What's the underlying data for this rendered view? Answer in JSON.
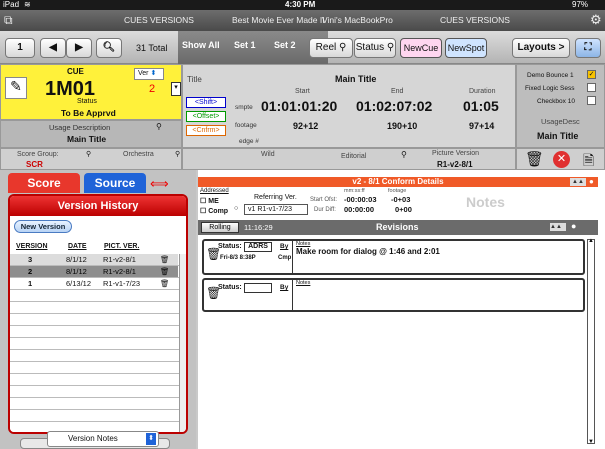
{
  "status_bar": {
    "device": "iPad",
    "time": "4:30 PM",
    "battery": "97%"
  },
  "title_bar": {
    "app": "CUES VERSIONS",
    "project": "Best Movie Ever Made II",
    "machine": "Vini's MacBookPro",
    "section": "CUES VERSIONS"
  },
  "toolbar": {
    "record_number": "1",
    "total": "31 Total",
    "show_all": "Show All",
    "set1": "Set 1",
    "set2": "Set 2",
    "reel": "Reel",
    "status": "Status",
    "new_cue": "NewCue",
    "new_spot": "NewSpot",
    "layouts": "Layouts >"
  },
  "cue": {
    "label": "CUE",
    "ver_label": "Ver",
    "number": "1M01",
    "version": "2",
    "status_label": "Status",
    "status_value": "To Be Apprvd"
  },
  "usage": {
    "label": "Usage Description",
    "value": "Main Title"
  },
  "score_group": {
    "label": "Score Group:",
    "value": "SCR",
    "orchestra_label": "Orchestra"
  },
  "timing": {
    "title_label": "Title",
    "title_value": "Main Title",
    "start_label": "Start",
    "end_label": "End",
    "duration_label": "Duration",
    "shift": "<Shift>",
    "offset": "<Offset>",
    "cnfrm": "<Cnfrm>",
    "smpte_label": "smpte",
    "start_smpte": "01:01:01:20",
    "end_smpte": "01:02:07:02",
    "dur_smpte": "01:05",
    "footage_label": "footage",
    "start_footage": "92+12",
    "end_footage": "190+10",
    "dur_footage": "97+14",
    "edge_label": "edge #"
  },
  "right_panel": {
    "items": [
      "Demo Bounce 1",
      "Fixed Logic Sess",
      "Checkbox 10"
    ],
    "usage_desc_label": "UsageDesc",
    "usage_desc_value": "Main Title"
  },
  "wild_row": {
    "wild_label": "Wild",
    "editorial_label": "Editorial",
    "picture_version_label": "Picture Version",
    "picture_version_value": "R1-v2-8/1"
  },
  "left": {
    "tab_score": "Score",
    "tab_source": "Source",
    "version_history_title": "Version History",
    "new_version": "New Version",
    "columns": [
      "VERSION",
      "DATE",
      "PICT. VER."
    ],
    "rows": [
      [
        "3",
        "8/1/12",
        "R1-v2-8/1"
      ],
      [
        "2",
        "8/1/12",
        "R1-v2-8/1"
      ],
      [
        "1",
        "6/13/12",
        "R1-v1-7/23"
      ]
    ],
    "version_notes": "Version Notes"
  },
  "conform": {
    "header": "v2 - 8/1  Conform Details",
    "addressed_label": "Addressed",
    "me_label": "ME",
    "comp_label": "Comp",
    "referring_label": "Referring Ver.",
    "referring_value": "v1  R1-v1-7/23",
    "smpte_head": "mm:ss:ff",
    "footage_head": "footage",
    "start_ofst_label": "Start Ofst:",
    "start_ofst_smpte": "-00:00:03",
    "start_ofst_ft": "-0+03",
    "dur_diff_label": "Dur Diff:",
    "dur_diff_smpte": "00:00:00",
    "dur_diff_ft": "0+00",
    "notes_label": "Notes"
  },
  "revisions": {
    "rolling": "Rolling",
    "time": "11:16:29",
    "title": "Revisions",
    "items": [
      {
        "status_label": "Status:",
        "status_value": "ADRS",
        "by_label": "By",
        "date": "Fri-8/3 8:38P",
        "by_value": "Cmp",
        "notes_label": "Notes",
        "note": "Make room for dialog @ 1:46 and 2:01"
      },
      {
        "status_label": "Status:",
        "status_value": "",
        "by_label": "By",
        "date": "",
        "by_value": "",
        "notes_label": "Notes",
        "note": ""
      }
    ]
  }
}
